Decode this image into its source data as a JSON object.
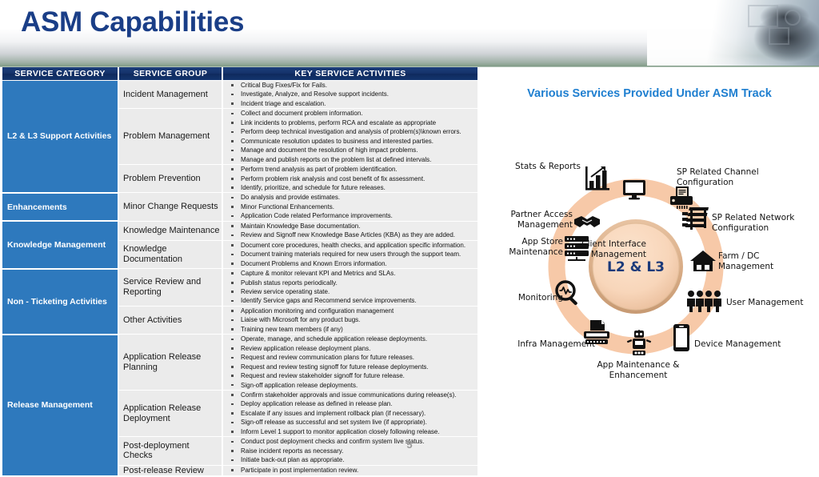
{
  "slide": {
    "title": "ASM Capabilities",
    "number": "5"
  },
  "table": {
    "headers": [
      "SERVICE CATEGORY",
      "SERVICE GROUP",
      "KEY SERVICE ACTIVITIES"
    ],
    "categories": [
      {
        "label": "L2 & L3 Support Activities",
        "groups": [
          {
            "label": "Incident Management",
            "activities": [
              "Critical Bug Fixes/Fix for Fails.",
              "Investigate, Analyze, and Resolve support incidents.",
              "Incident triage and escalation."
            ]
          },
          {
            "label": "Problem Management",
            "activities": [
              "Collect and document problem information.",
              "Link incidents to problems, perform RCA and escalate as appropriate",
              "Perform deep technical investigation and analysis of problem(s)\\known errors.",
              "Communicate resolution updates to business and interested parties.",
              "Manage and document the resolution of high impact problems.",
              "Manage and publish reports on the problem list at defined intervals."
            ]
          },
          {
            "label": "Problem Prevention",
            "activities": [
              "Perform trend analysis as part of problem identification.",
              "Perform problem risk analysis and cost benefit of fix assessment.",
              "Identify, prioritize, and schedule for future releases."
            ]
          }
        ]
      },
      {
        "label": "Enhancements",
        "groups": [
          {
            "label": "Minor Change Requests",
            "activities": [
              "Do analysis and provide estimates.",
              "Minor Functional Enhancements.",
              "Application Code related Performance improvements."
            ]
          }
        ]
      },
      {
        "label": "Knowledge Management",
        "groups": [
          {
            "label": "Knowledge Maintenance",
            "activities": [
              "Maintain Knowledge Base documentation.",
              "Review and Signoff new Knowledge Base Articles (KBA) as they are added."
            ]
          },
          {
            "label": "Knowledge Documentation",
            "activities": [
              "Document core procedures, health checks, and application specific information.",
              "Document training materials required for new users through the support team.",
              "Document Problems and Known Errors information."
            ]
          }
        ]
      },
      {
        "label": "Non - Ticketing Activities",
        "groups": [
          {
            "label": "Service Review and Reporting",
            "activities": [
              "Capture & monitor relevant KPI and Metrics and SLAs.",
              "Publish status reports periodically.",
              "Review service operating state.",
              "Identify Service gaps and Recommend service improvements."
            ]
          },
          {
            "label": "Other Activities",
            "activities": [
              "Application monitoring and configuration management",
              "Liaise with Microsoft for any product bugs.",
              "Training new team members (if any)"
            ]
          }
        ]
      },
      {
        "label": "Release Management",
        "groups": [
          {
            "label": "Application Release Planning",
            "activities": [
              "Operate, manage, and schedule application release deployments.",
              "Review application release deployment plans.",
              "Request and review communication plans for future releases.",
              "Request and review testing signoff for future release deployments.",
              "Request and review stakeholder signoff for future release.",
              "Sign-off application release deployments."
            ]
          },
          {
            "label": "Application Release Deployment",
            "activities": [
              "Confirm stakeholder approvals and issue communications during release(s).",
              "Deploy application release as defined in release plan.",
              "Escalate if any issues and implement rollback plan (if necessary).",
              "Sign-off release as successful and set system live (if appropriate).",
              "Inform Level 1 support to monitor application closely following release."
            ]
          },
          {
            "label": "Post-deployment Checks",
            "activities": [
              "Conduct post deployment checks and confirm system live status.",
              "Raise incident reports as necessary.",
              "Initiate back-out plan as appropriate."
            ]
          },
          {
            "label": "Post-release Review",
            "activities": [
              "Participate in post implementation review."
            ]
          }
        ]
      }
    ]
  },
  "diagram": {
    "title": "Various Services Provided Under ASM Track",
    "center_label": "L2 & L3",
    "ring_color": "#f7c9a8",
    "center_fill": "#f8d6ba",
    "title_color": "#1f7fd0",
    "nodes": [
      {
        "label": "Client Interface Management",
        "icon": "monitor-icon",
        "glyph": "🖥"
      },
      {
        "label": "SP Related Channel Configuration",
        "icon": "printer-icon",
        "glyph": "🖨"
      },
      {
        "label": "SP Related Network Configuration",
        "icon": "network-rack-icon",
        "glyph": "🗄"
      },
      {
        "label": "Farm / DC Management",
        "icon": "house-icon",
        "glyph": "🏠"
      },
      {
        "label": "User Management",
        "icon": "people-icon",
        "glyph": "👥"
      },
      {
        "label": "Device Management",
        "icon": "mobile-phone-icon",
        "glyph": "📱"
      },
      {
        "label": "App Maintenance & Enhancement",
        "icon": "robot-icon",
        "glyph": "🤖"
      },
      {
        "label": "Infra Management",
        "icon": "typewriter-icon",
        "glyph": "🖶"
      },
      {
        "label": "Monitoring",
        "icon": "magnifier-pulse-icon",
        "glyph": "🔍"
      },
      {
        "label": "App Store Maintenance",
        "icon": "server-stack-icon",
        "glyph": "🗄"
      },
      {
        "label": "Partner Access Management",
        "icon": "handshake-icon",
        "glyph": "🤝"
      },
      {
        "label": "Stats & Reports",
        "icon": "bar-chart-icon",
        "glyph": "📊"
      }
    ]
  }
}
